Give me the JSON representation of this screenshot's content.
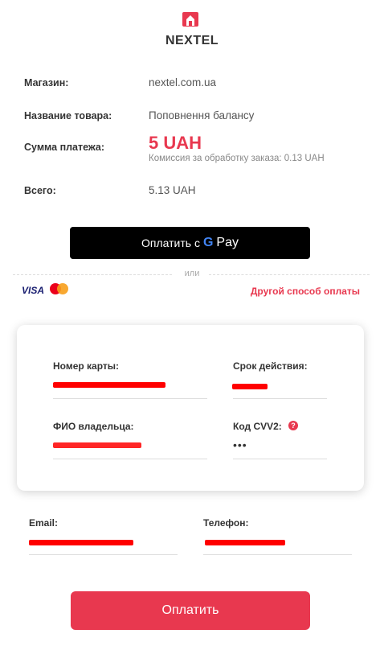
{
  "brand": {
    "name": "NEXTEL",
    "accent_color": "#e8384f"
  },
  "summary": {
    "store_label": "Магазин:",
    "store_value": "nextel.com.ua",
    "product_label": "Название товара:",
    "product_value": "Поповнення балансу",
    "amount_label": "Сумма платежа:",
    "amount_value": "5 UAH",
    "commission": "Комиссия за обработку заказа: 0.13 UAH",
    "total_label": "Всего:",
    "total_value": "5.13 UAH"
  },
  "gpay": {
    "label": "Оплатить с",
    "g": "G",
    "pay": "Pay"
  },
  "divider": "или",
  "cards": {
    "visa": "VISA",
    "other_method": "Другой способ оплаты"
  },
  "form": {
    "card_number_label": "Номер карты:",
    "expiry_label": "Срок действия:",
    "holder_label": "ФИО владельца:",
    "cvv_label": "Код CVV2:",
    "cvv_help": "?",
    "cvv_value": "•••",
    "email_label": "Email:",
    "phone_label": "Телефон:"
  },
  "submit_label": "Оплатить"
}
